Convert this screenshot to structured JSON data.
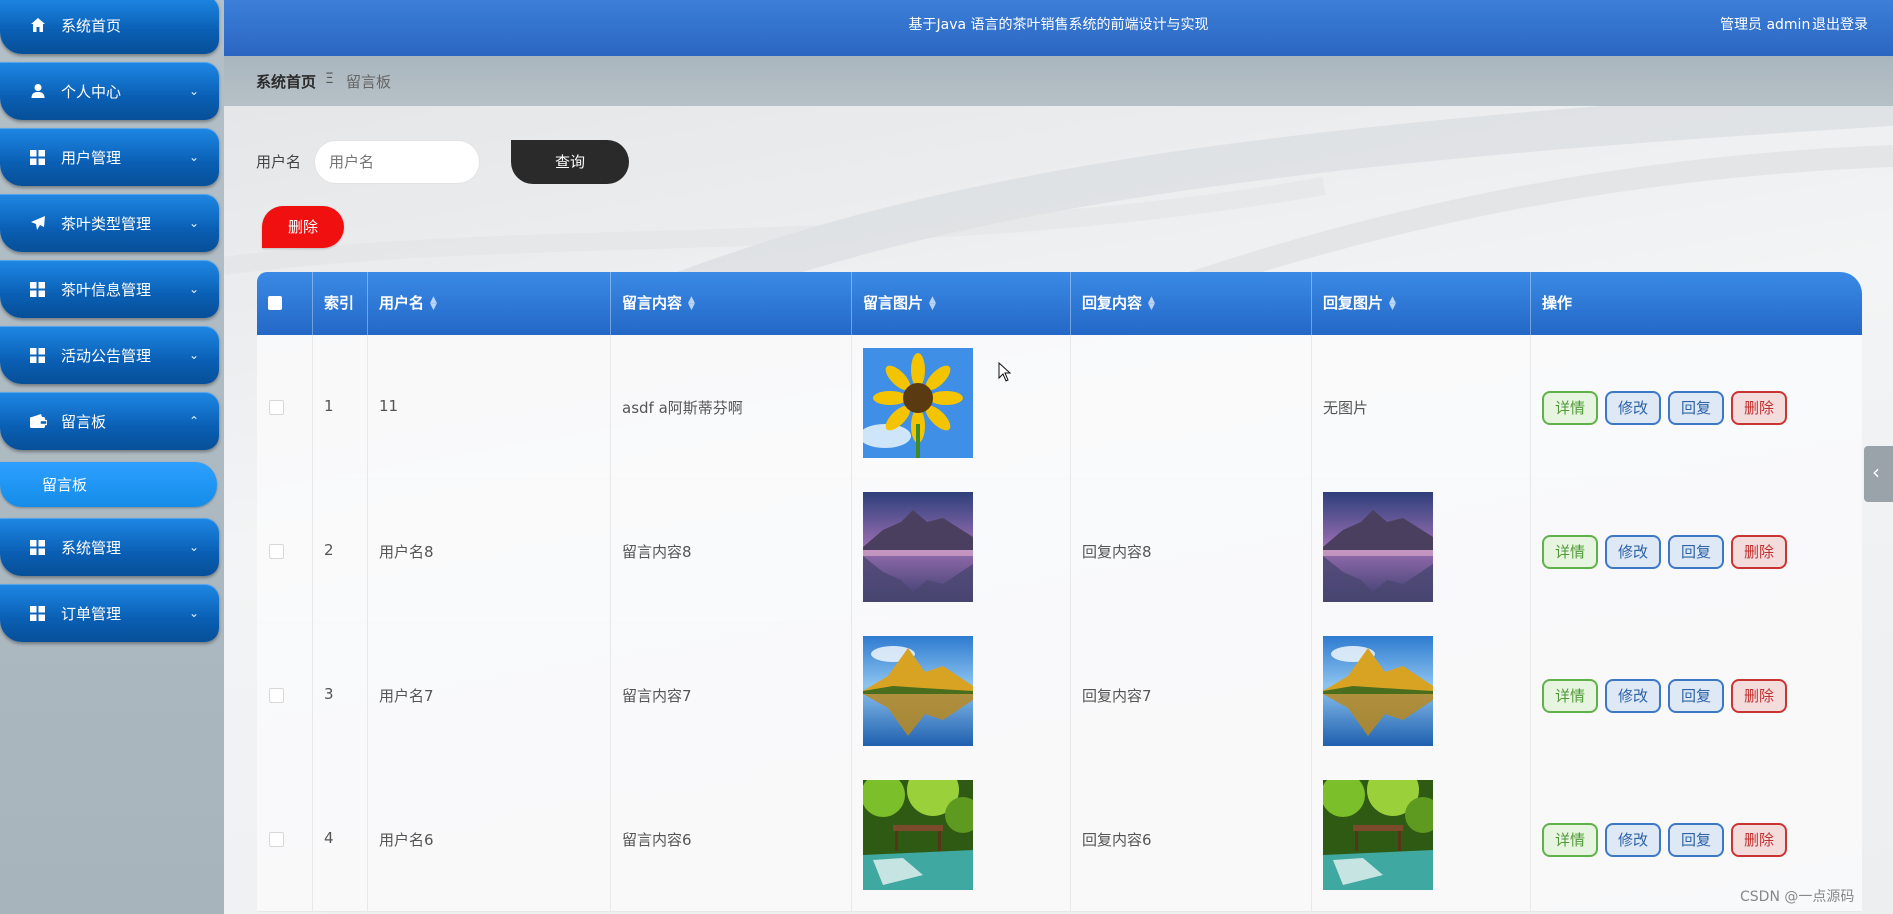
{
  "header": {
    "title": "基于Java 语言的茶叶销售系统的前端设计与实现",
    "admin_label": "管理员 admin",
    "logout_label": "退出登录"
  },
  "sidebar": {
    "items": [
      {
        "label": "系统首页",
        "icon": "home-icon",
        "expandable": false
      },
      {
        "label": "个人中心",
        "icon": "user-icon",
        "expandable": true
      },
      {
        "label": "用户管理",
        "icon": "grid-icon",
        "expandable": true
      },
      {
        "label": "茶叶类型管理",
        "icon": "paper-plane-icon",
        "expandable": true
      },
      {
        "label": "茶叶信息管理",
        "icon": "grid-icon",
        "expandable": true
      },
      {
        "label": "活动公告管理",
        "icon": "grid-icon",
        "expandable": true
      },
      {
        "label": "留言板",
        "icon": "wallet-icon",
        "expandable": true,
        "expanded": true
      },
      {
        "label": "系统管理",
        "icon": "grid-icon",
        "expandable": true
      },
      {
        "label": "订单管理",
        "icon": "grid-icon",
        "expandable": true
      }
    ],
    "sub_item": "留言板"
  },
  "breadcrumb": {
    "home": "系统首页",
    "separator": "Ξ",
    "current": "留言板"
  },
  "search": {
    "label": "用户名",
    "placeholder": "用户名",
    "value": "",
    "button": "查询"
  },
  "toolbar": {
    "delete_label": "删除"
  },
  "table": {
    "columns": [
      "索引",
      "用户名",
      "留言内容",
      "留言图片",
      "回复内容",
      "回复图片",
      "操作"
    ],
    "rows": [
      {
        "index": "1",
        "username": "11",
        "content": "asdf a阿斯蒂芬啊",
        "image": "sunflower",
        "reply": "",
        "reply_image": "",
        "reply_image_text": "无图片"
      },
      {
        "index": "2",
        "username": "用户名8",
        "content": "留言内容8",
        "image": "mountain-lake",
        "reply": "回复内容8",
        "reply_image": "mountain-lake",
        "reply_image_text": ""
      },
      {
        "index": "3",
        "username": "用户名7",
        "content": "留言内容7",
        "image": "autumn-mountain",
        "reply": "回复内容7",
        "reply_image": "autumn-mountain",
        "reply_image_text": ""
      },
      {
        "index": "4",
        "username": "用户名6",
        "content": "留言内容6",
        "image": "forest-waterfall",
        "reply": "回复内容6",
        "reply_image": "forest-waterfall",
        "reply_image_text": ""
      }
    ],
    "actions": {
      "detail": "详情",
      "edit": "修改",
      "reply": "回复",
      "delete": "删除"
    }
  },
  "watermark": "CSDN @一点源码",
  "colors": {
    "menu_blue": "#0a5fb4",
    "header_blue": "#2a66c2",
    "danger": "#f01010",
    "dark_button": "#2a2a2a"
  }
}
